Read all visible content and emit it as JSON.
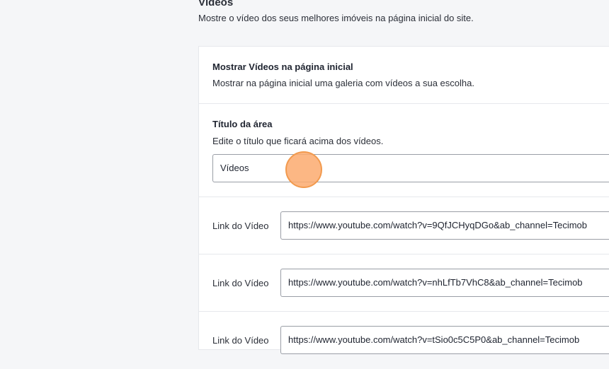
{
  "section": {
    "title": "Vídeos",
    "description": "Mostre o vídeo dos seus melhores imóveis na página inicial do site."
  },
  "show_videos": {
    "label": "Mostrar Vídeos na página inicial",
    "description": "Mostrar na página inicial uma galeria com vídeos a sua escolha."
  },
  "area_title": {
    "label": "Título da área",
    "description": "Edite o título que ficará acima dos vídeos.",
    "value": "Vídeos"
  },
  "video_links": [
    {
      "label": "Link do Vídeo",
      "value": "https://www.youtube.com/watch?v=9QfJCHyqDGo&ab_channel=Tecimob"
    },
    {
      "label": "Link do Vídeo",
      "value": "https://www.youtube.com/watch?v=nhLfTb7VhC8&ab_channel=Tecimob"
    },
    {
      "label": "Link do Vídeo",
      "value": "https://www.youtube.com/watch?v=tSio0c5C5P0&ab_channel=Tecimob"
    }
  ],
  "colors": {
    "page_background": "#f5f6f8",
    "card_background": "#ffffff",
    "click_indicator": "#f29a4e"
  }
}
